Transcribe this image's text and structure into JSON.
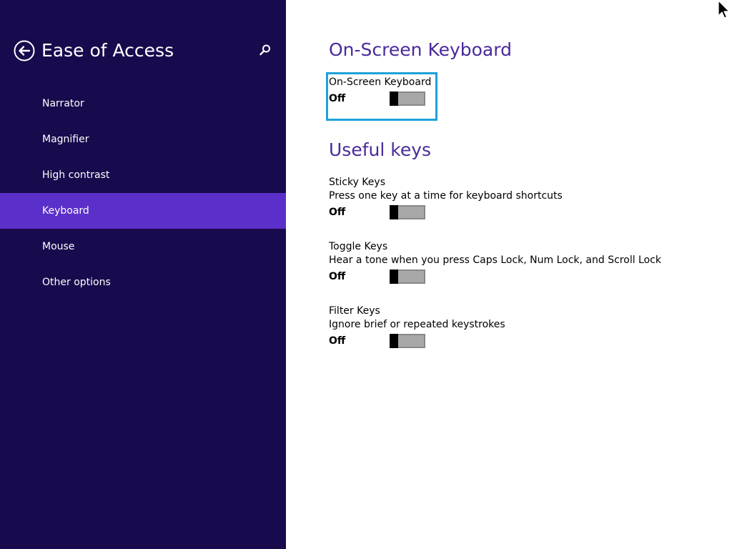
{
  "sidebar": {
    "title": "Ease of Access",
    "back_icon": "back-arrow-icon",
    "search_icon": "search-icon",
    "items": [
      {
        "label": "Narrator"
      },
      {
        "label": "Magnifier"
      },
      {
        "label": "High contrast"
      },
      {
        "label": "Keyboard",
        "selected": true
      },
      {
        "label": "Mouse"
      },
      {
        "label": "Other options"
      }
    ]
  },
  "main": {
    "osk_section": {
      "title": "On-Screen Keyboard",
      "setting": {
        "name": "On-Screen Keyboard",
        "state": "Off"
      }
    },
    "useful_keys": {
      "title": "Useful keys",
      "settings": [
        {
          "name": "Sticky Keys",
          "description": "Press one key at a time for keyboard shortcuts",
          "state": "Off"
        },
        {
          "name": "Toggle Keys",
          "description": "Hear a tone when you press Caps Lock, Num Lock, and Scroll Lock",
          "state": "Off"
        },
        {
          "name": "Filter Keys",
          "description": "Ignore brief or repeated keystrokes",
          "state": "Off"
        }
      ]
    }
  },
  "colors": {
    "sidebar_bg": "#180a4d",
    "selected_item_bg": "#5b2fc9",
    "heading": "#4a2a9c",
    "focus_outline": "#1ea1d9"
  }
}
